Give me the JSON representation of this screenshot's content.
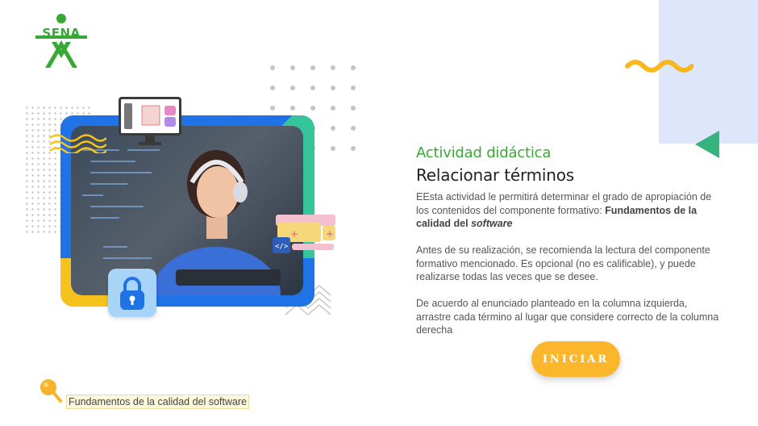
{
  "brand": {
    "logo_text": "SENA",
    "color": "#39a935"
  },
  "activity": {
    "kicker": "Actividad didáctica",
    "title": "Relacionar términos",
    "p1_a": "EEsta actividad le permitirá determinar el grado de apropiación de los contenidos del componente formativo: ",
    "p1_b": "Fundamentos de la calidad del ",
    "p1_c": "software",
    "p2": "Antes de su realización, se recomienda la lectura del componente formativo mencionado.  Es opcional (no es calificable), y puede realizarse todas las veces que se desee.",
    "p3": "De acuerdo al enunciado planteado en la columna izquierda, arrastre cada término al lugar que considere correcto de la columna derecha"
  },
  "button": {
    "label": "INICIAR",
    "color": "#fbb62b"
  },
  "footer": {
    "course": "Fundamentos de la calidad del software"
  },
  "accent_colors": {
    "green": "#39a935",
    "blue": "#1f73e6",
    "teal": "#36c49a",
    "yellow": "#f6c31c",
    "panel": "#dde6fb"
  },
  "icons": [
    "sena-logo-icon",
    "lock-icon",
    "code-icon",
    "pushpin-icon",
    "monitor-icon"
  ]
}
